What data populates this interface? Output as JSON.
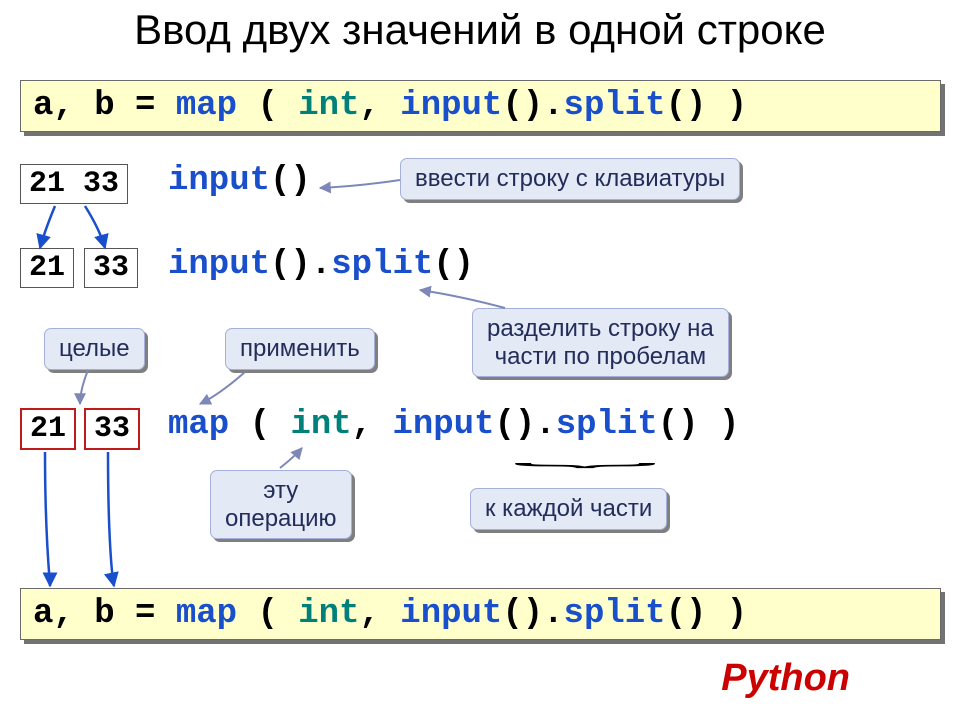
{
  "title": "Ввод двух значений в одной строке",
  "code_main": {
    "t1": "a, b = ",
    "t2": "map",
    "t3": " ( ",
    "t4": "int",
    "t5": ", ",
    "t6": "input",
    "t7": "().",
    "t8": "split",
    "t9": "() )"
  },
  "nums": {
    "pair": "21 33",
    "a": "21",
    "b": "33"
  },
  "line1": {
    "a": "input",
    "b": "()"
  },
  "line2": {
    "a": "input",
    "b": "().",
    "c": "split",
    "d": "()"
  },
  "line3": {
    "a": "map",
    "b": " ( ",
    "c": "int",
    "d": ", ",
    "e": "input",
    "f": "().",
    "g": "split",
    "h": "() )"
  },
  "callouts": {
    "c1": "ввести строку с клавиатуры",
    "c2": "целые",
    "c3": "применить",
    "c4a": "разделить строку на",
    "c4b": "части по пробелам",
    "c5a": "эту",
    "c5b": "операцию",
    "c6": "к каждой части"
  },
  "footer": "Python"
}
